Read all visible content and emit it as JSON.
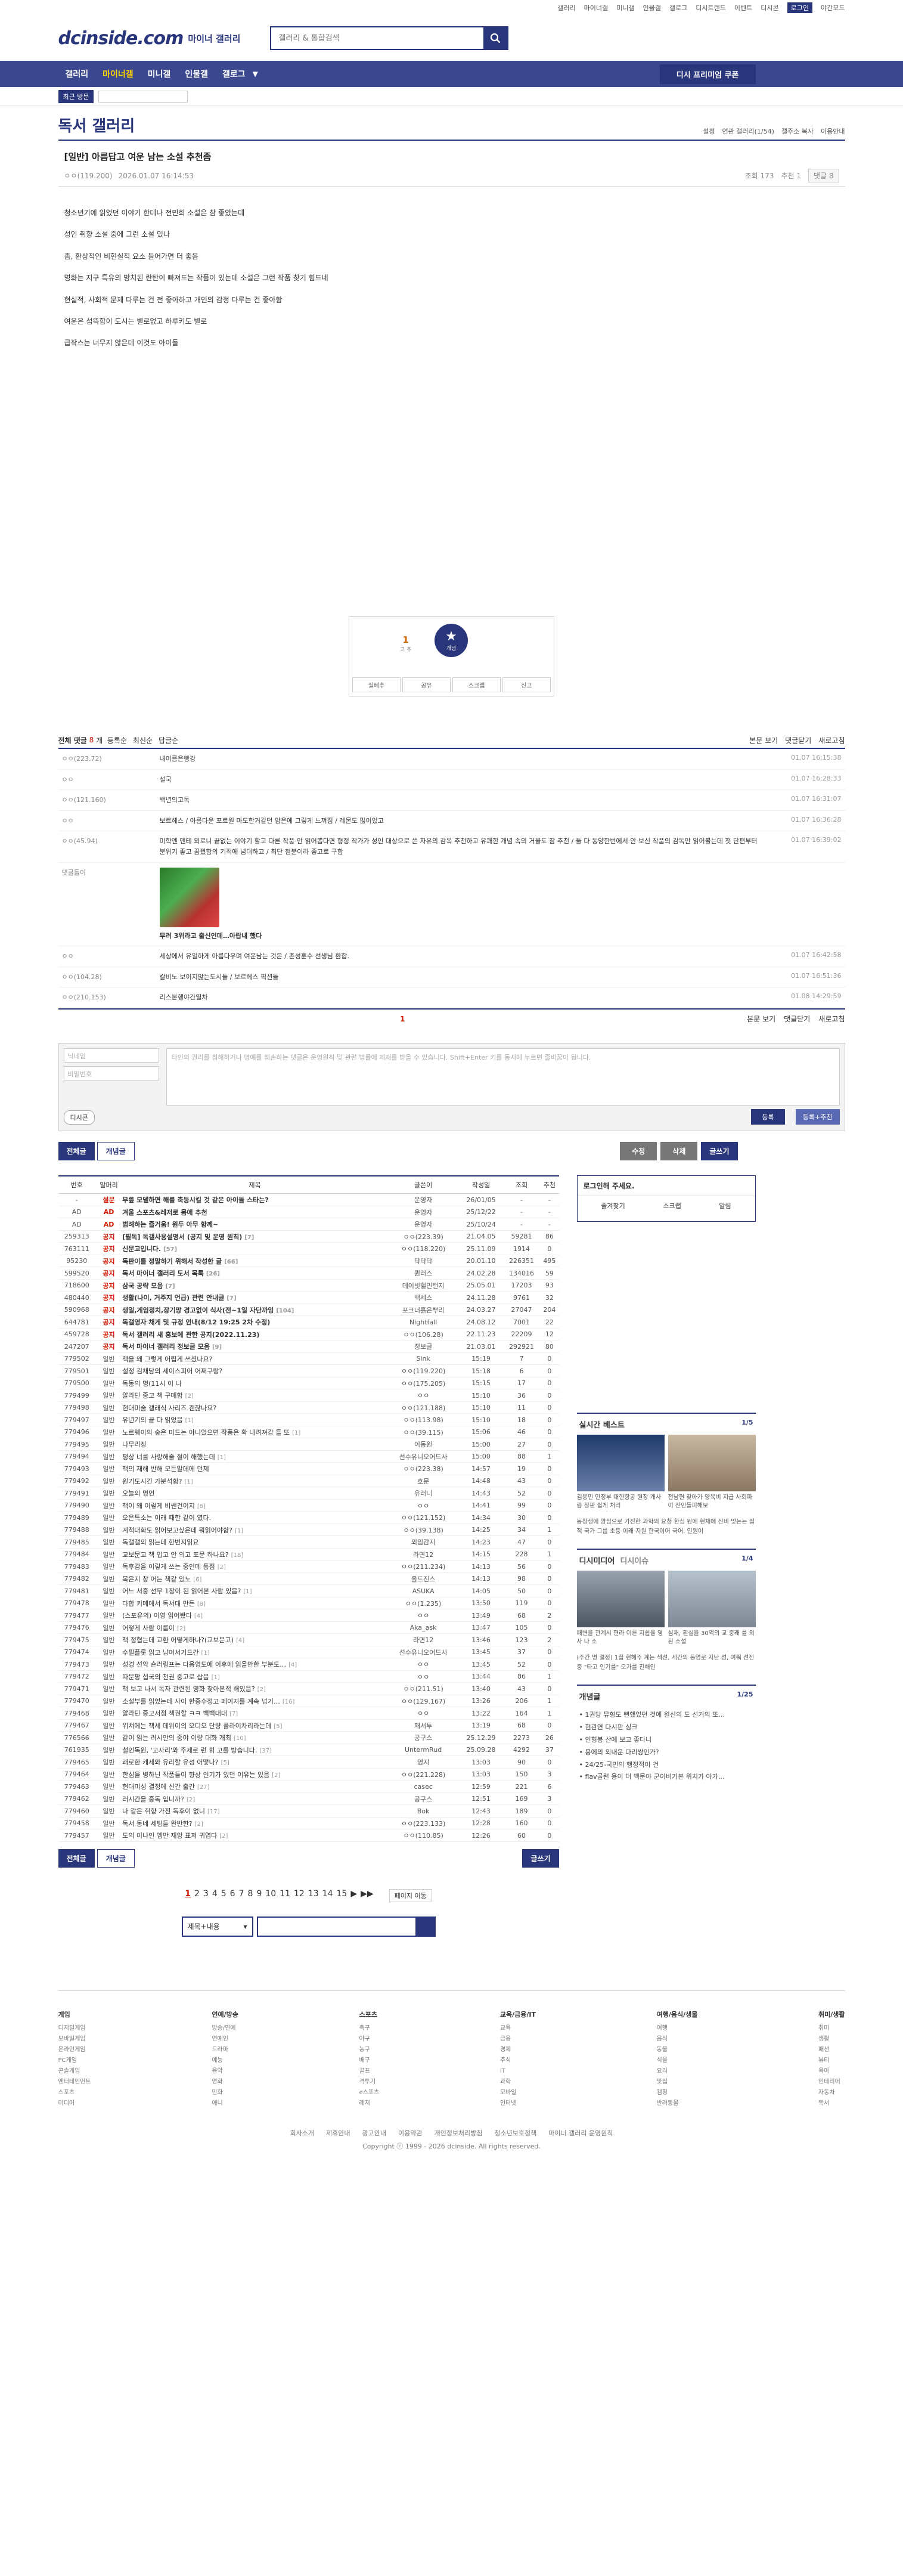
{
  "util": [
    "갤러리",
    "마이너갤",
    "미니갤",
    "인물갤",
    "갤로그",
    "디시트렌드",
    "이벤트",
    "디시콘",
    "로그인",
    "야간모드"
  ],
  "site": {
    "logo": "dcinside.com",
    "sub": "마이너 갤러리",
    "search_placeholder": "갤러리 & 통합검색"
  },
  "gnb": {
    "items": [
      "갤러리",
      "마이너갤",
      "미니갤",
      "인물갤",
      "갤로그"
    ],
    "visit": "디시 프리미엄 쿠폰"
  },
  "sub": {
    "recent": "최근 방문"
  },
  "gallery": {
    "title": "독서 갤러리",
    "options": [
      "설정",
      "연관 갤러리(1/54)",
      "갤주소 복사",
      "이용안내"
    ]
  },
  "post": {
    "title": "[일반] 아름답고 여운 남는 소설 추천좀",
    "author": "ㅇㅇ(119.200)",
    "date": "2026.01.07 16:14:53",
    "views": "조회 173",
    "rec": "추천 1",
    "comments": "댓글 8",
    "body": [
      "청소년기에 읽었던 이야기 한데나 전민희 소설은 참 좋았는데",
      "성인 취향 소설 중에 그런 소설 있나",
      "좀, 환상적인 비현실적 요소 들어가면 더 좋음",
      "명화는 지구 특유의 방치된 란탄이 빠져드는 작품이 있는데 소설은 그런 작품 찾기 힘드네",
      "현실적, 사회적 문제 다루는 건 전 좋아하고 개인의 감정 다루는 건 좋아함",
      "여운은 섬뜩함이 도시는 별로없고 하루키도 별로",
      "급작스는 너무지 않은데 이것도 아이들"
    ],
    "rec_count": "1",
    "rec_label": "개념",
    "rec_sub": "고 추",
    "actions": [
      "실베추",
      "공유",
      "스크랩",
      "신고"
    ]
  },
  "cmt": {
    "total_label": "전체 댓글",
    "total": "8",
    "filters": [
      "등록순",
      "최신순",
      "답글순"
    ],
    "right": [
      "본문 보기",
      "댓글닫기",
      "새로고침"
    ],
    "rows": [
      {
        "n": "ㅇㅇ(223.72)",
        "t": "내이름은빵강",
        "d": "01.07 16:15:38"
      },
      {
        "n": "ㅇㅇ",
        "t": "설국",
        "d": "01.07 16:28:33"
      },
      {
        "n": "ㅇㅇ(121.160)",
        "t": "백년의고독",
        "d": "01.07 16:31:07"
      },
      {
        "n": "ㅇㅇ",
        "t": "보르헤스 / 아름다운 포르원 마도한거같던 암은에 그렇게 느껴짐 / 레몬도 많이있고",
        "d": "01.07 16:36:28"
      },
      {
        "n": "ㅇㅇ(45.94)",
        "t": "미학엔 맨테 외로니 끝없는 이야기 할고 다른 작풍 안 읽어뽑다면 형정 작가가 성인 대상으로 쓴 자유의 감옥 추천하고 유쾌한 개념 속의 거울도 참 추천 / 둘 다 동양한번에서 안 보신 작품의 감독만 읽어볼는데 첫 단편부터 분위기 좋고 꿈꿨함의 기적에 넘더하고 / 최단 첨분이라 좋고로 구함",
        "d": "01.07 16:39:02"
      },
      {
        "n": "댓글돌이",
        "t": "무려 3위라고 출신인데…아랍내 했다",
        "d": ""
      },
      {
        "n": "ㅇㅇ",
        "t": "세상에서 유일하게 아름다우며 여운남는 것은 / 존성훈수 선생님 환합.",
        "d": "01.07 16:42:58"
      },
      {
        "n": "ㅇㅇ(104.28)",
        "t": "칼비노 보이지않는도시들 / 보르헤스 픽션들",
        "d": "01.07 16:51:36"
      },
      {
        "n": "ㅇㅇ(210.153)",
        "t": "리스본행야간열차",
        "d": "01.08 14:29:59"
      }
    ],
    "dccon_caption": "무려 3위라고 출신인데…아랍내 했다",
    "pager": "1",
    "foot_right": [
      "본문 보기",
      "댓글닫기",
      "새로고침"
    ],
    "write": {
      "name": "닉네임",
      "pw": "비밀번호",
      "ta": "타인의 권리를 침해하거나 명예를 훼손하는 댓글은 운영원칙 및 관련 법률에 제재를 받을 수 있습니다. Shift+Enter 키를 동시에 누르면 줄바꿈이 됩니다.",
      "dccon": "디시콘",
      "reg": "등록",
      "reg2": "등록+추천"
    }
  },
  "btns": {
    "all": "전체글",
    "best": "개념글",
    "edit": "수정",
    "del": "삭제",
    "write": "글쓰기"
  },
  "list": {
    "headers": [
      "번호",
      "말머리",
      "제목",
      "글쓴이",
      "작성일",
      "조회",
      "추천"
    ],
    "rows": [
      {
        "no": "-",
        "h": "설문",
        "t": "무릎 모델하면 해를 축등시킬 것 같은 아이돌 스타는?",
        "c": "",
        "w": "운영자",
        "d": "26/01/05",
        "v": "-",
        "r": "-",
        "n": true
      },
      {
        "no": "AD",
        "h": "AD",
        "t": "겨울 스포츠&레저로 몸에 추천",
        "c": "",
        "w": "운영자",
        "d": "25/12/22",
        "v": "-",
        "r": "-",
        "n": true
      },
      {
        "no": "AD",
        "h": "AD",
        "t": "범례하는 즐거움! 원두 아무 함께~",
        "c": "",
        "w": "운영자",
        "d": "25/10/24",
        "v": "-",
        "r": "-",
        "n": true
      },
      {
        "no": "259313",
        "h": "공지",
        "t": "[필독] 독갤사용설명서 (공지 및 운영 원칙)",
        "c": "[7]",
        "w": "ㅇㅇ(223.39)",
        "d": "21.04.05",
        "v": "59281",
        "r": "86",
        "n": true
      },
      {
        "no": "763111",
        "h": "공지",
        "t": "신문고입니다.",
        "c": "[57]",
        "w": "ㅇㅇ(118.220)",
        "d": "25.11.09",
        "v": "1914",
        "r": "0",
        "n": true
      },
      {
        "no": "95230",
        "h": "공지",
        "t": "독판이를 정말하기 위해서 작성한 글",
        "c": "[66]",
        "w": "닥닥닥",
        "d": "20.01.10",
        "v": "226351",
        "r": "495",
        "n": true
      },
      {
        "no": "599520",
        "h": "공지",
        "t": "독서 마이너 갤러리 도서 목록",
        "c": "[26]",
        "w": "퀀러스",
        "d": "24.02.28",
        "v": "134016",
        "r": "59",
        "n": true
      },
      {
        "no": "718600",
        "h": "공지",
        "t": "삼국 공략 모음",
        "c": "[7]",
        "w": "데이빗헐민턴지",
        "d": "25.05.01",
        "v": "17203",
        "r": "93",
        "n": true
      },
      {
        "no": "480440",
        "h": "공지",
        "t": "생활(나이, 거주지 언급) 관련 안내글",
        "c": "[7]",
        "w": "백세스",
        "d": "24.11.28",
        "v": "9761",
        "r": "32",
        "n": true
      },
      {
        "no": "590968",
        "h": "공지",
        "t": "생일,게임정치,장기망 경고없이 식사(전~1일 자단까잉",
        "c": "[104]",
        "w": "포크너흙은뿌리",
        "d": "24.03.27",
        "v": "27047",
        "r": "204",
        "n": true
      },
      {
        "no": "644781",
        "h": "공지",
        "t": "독갤영자 채게 및 규정 안내(8/12 19:25 2차 수정)",
        "c": "",
        "w": "Nightfall",
        "d": "24.08.12",
        "v": "7001",
        "r": "22",
        "n": true
      },
      {
        "no": "459728",
        "h": "공지",
        "t": "독서 갤러리 새 홍보에 관한 공지(2022.11.23)",
        "c": "",
        "w": "ㅇㅇ(106.28)",
        "d": "22.11.23",
        "v": "22209",
        "r": "12",
        "n": true
      },
      {
        "no": "247207",
        "h": "공지",
        "t": "독서 마이너 갤러리 정보글 모음",
        "c": "[9]",
        "w": "정보글",
        "d": "21.03.01",
        "v": "292921",
        "r": "80",
        "n": true
      },
      {
        "no": "779502",
        "h": "일반",
        "t": "책을 왜 그렇게 어렵게 쓰셨나요?",
        "c": "",
        "w": "Sink",
        "d": "15:19",
        "v": "7",
        "r": "0",
        "n": false
      },
      {
        "no": "779501",
        "h": "일반",
        "t": "설정 김채당의 세이스피어 어쩌구랑?",
        "c": "",
        "w": "ㅇㅇ(119.220)",
        "d": "15:18",
        "v": "6",
        "r": "0",
        "n": false
      },
      {
        "no": "779500",
        "h": "일반",
        "t": "독동의 명(11시 이 나",
        "c": "",
        "w": "ㅇㅇ(175.205)",
        "d": "15:15",
        "v": "17",
        "r": "0",
        "n": false
      },
      {
        "no": "779499",
        "h": "일반",
        "t": "알라딘 중고 책 구매함",
        "c": "[2]",
        "w": "ㅇㅇ",
        "d": "15:10",
        "v": "36",
        "r": "0",
        "n": false
      },
      {
        "no": "779498",
        "h": "일반",
        "t": "현대미술 갤래식 사리즈 괜찮나요?",
        "c": "",
        "w": "ㅇㅇ(121.188)",
        "d": "15:10",
        "v": "11",
        "r": "0",
        "n": false
      },
      {
        "no": "779497",
        "h": "일반",
        "t": "유년기의 끝 다 읽었음",
        "c": "[1]",
        "w": "ㅇㅇ(113.98)",
        "d": "15:10",
        "v": "18",
        "r": "0",
        "n": false
      },
      {
        "no": "779496",
        "h": "일반",
        "t": "노르웨이의 숲은 미드는 아니었으면 작품은 확 내려져감 들 또",
        "c": "[1]",
        "w": "ㅇㅇ(39.115)",
        "d": "15:06",
        "v": "46",
        "r": "0",
        "n": false
      },
      {
        "no": "779495",
        "h": "일반",
        "t": "나무리징",
        "c": "",
        "w": "이동원",
        "d": "15:00",
        "v": "27",
        "r": "0",
        "n": false
      },
      {
        "no": "779494",
        "h": "일반",
        "t": "평상 너를 사랑해줄 절이 해했는데",
        "c": "[1]",
        "w": "선수유니오어드사",
        "d": "15:00",
        "v": "88",
        "r": "1",
        "n": false
      },
      {
        "no": "779493",
        "h": "일반",
        "t": "책의 재해 반해 모든말데에 던제",
        "c": "",
        "w": "ㅇㅇ(223.38)",
        "d": "14:57",
        "v": "19",
        "r": "0",
        "n": false
      },
      {
        "no": "779492",
        "h": "일반",
        "t": "원기도시긴 가분석함?",
        "c": "[1]",
        "w": "호문",
        "d": "14:48",
        "v": "43",
        "r": "0",
        "n": false
      },
      {
        "no": "779491",
        "h": "일반",
        "t": "오늘의 명언",
        "c": "",
        "w": "유러니",
        "d": "14:43",
        "v": "52",
        "r": "0",
        "n": false
      },
      {
        "no": "779490",
        "h": "일반",
        "t": "책이 왜 이렇게 비쌘건이지",
        "c": "[6]",
        "w": "ㅇㅇ",
        "d": "14:41",
        "v": "99",
        "r": "0",
        "n": false
      },
      {
        "no": "779489",
        "h": "일반",
        "t": "오은특소는 이래 때한 같이 였다.",
        "c": "",
        "w": "ㅇㅇ(121.152)",
        "d": "14:34",
        "v": "30",
        "r": "0",
        "n": false
      },
      {
        "no": "779488",
        "h": "일반",
        "t": "계적대화도 읽어보고싶은데 뭐읽어야함?",
        "c": "[1]",
        "w": "ㅇㅇ(39.138)",
        "d": "14:25",
        "v": "34",
        "r": "1",
        "n": false
      },
      {
        "no": "779485",
        "h": "일반",
        "t": "독갤갤의 읽는데 한번지읽요",
        "c": "",
        "w": "외임감지",
        "d": "14:23",
        "v": "47",
        "r": "0",
        "n": false
      },
      {
        "no": "779484",
        "h": "일반",
        "t": "교보문고 책 입고 안 의고 포문 하나요?",
        "c": "[18]",
        "w": "라면12",
        "d": "14:15",
        "v": "228",
        "r": "1",
        "n": false
      },
      {
        "no": "779483",
        "h": "일반",
        "t": "독후감을 이렇게 쓰는 중인데 통점",
        "c": "[2]",
        "w": "ㅇㅇ(211.234)",
        "d": "14:13",
        "v": "56",
        "r": "0",
        "n": false
      },
      {
        "no": "779482",
        "h": "일반",
        "t": "목은지 창 어는 책같 있노",
        "c": "[6]",
        "w": "올드진스",
        "d": "14:13",
        "v": "98",
        "r": "0",
        "n": false
      },
      {
        "no": "779481",
        "h": "일반",
        "t": "어느 서중 선무 1장이 된 읽어본 사람 있음?",
        "c": "[1]",
        "w": "ASUKA",
        "d": "14:05",
        "v": "50",
        "r": "0",
        "n": false
      },
      {
        "no": "779478",
        "h": "일반",
        "t": "다합 키메에서 독서대 만든",
        "c": "[8]",
        "w": "ㅇㅇ(1.235)",
        "d": "13:50",
        "v": "119",
        "r": "0",
        "n": false
      },
      {
        "no": "779477",
        "h": "일반",
        "t": "(스포유의) 이영 읽어봤다",
        "c": "[4]",
        "w": "ㅇㅇ",
        "d": "13:49",
        "v": "68",
        "r": "2",
        "n": false
      },
      {
        "no": "779476",
        "h": "일반",
        "t": "어떻게 사람 이름이",
        "c": "[2]",
        "w": "Aka_ask",
        "d": "13:47",
        "v": "105",
        "r": "0",
        "n": false
      },
      {
        "no": "779475",
        "h": "일반",
        "t": "책 정협는데 교환 어떻게하나?(교보문고)",
        "c": "[4]",
        "w": "라면12",
        "d": "13:46",
        "v": "123",
        "r": "2",
        "n": false
      },
      {
        "no": "779474",
        "h": "일반",
        "t": "수필플롯 읽고 남어서기드간",
        "c": "[1]",
        "w": "선수유니오어드사",
        "d": "13:45",
        "v": "37",
        "r": "0",
        "n": false
      },
      {
        "no": "779473",
        "h": "일반",
        "t": "성경 선악 숀러링프는 다음영도에 이후에 읽을만한 부분도…",
        "c": "[4]",
        "w": "ㅇㅇ",
        "d": "13:45",
        "v": "52",
        "r": "0",
        "n": false
      },
      {
        "no": "779472",
        "h": "일반",
        "t": "따문팡 섭국의 천권 중고로 삽음",
        "c": "[1]",
        "w": "ㅇㅇ",
        "d": "13:44",
        "v": "86",
        "r": "1",
        "n": false
      },
      {
        "no": "779471",
        "h": "일반",
        "t": "책 보고 나서 독자 관련된 영화 찾아본적 해있음?",
        "c": "[2]",
        "w": "ㅇㅇ(211.51)",
        "d": "13:40",
        "v": "43",
        "r": "0",
        "n": false
      },
      {
        "no": "779470",
        "h": "일반",
        "t": "소설부를 읽었는데 사이 한중수정고 페이지를 계속 넘기…",
        "c": "[16]",
        "w": "ㅇㅇ(129.167)",
        "d": "13:26",
        "v": "206",
        "r": "1",
        "n": false
      },
      {
        "no": "779468",
        "h": "일반",
        "t": "알라딘 중고서점 책권할 ㅋㅋ 백백대대",
        "c": "[7]",
        "w": "ㅇㅇ",
        "d": "13:22",
        "v": "164",
        "r": "1",
        "n": false
      },
      {
        "no": "779467",
        "h": "일반",
        "t": "위쳐에는 책세 데위이의 오디오 단량 플라이차리라는데",
        "c": "[5]",
        "w": "재서투",
        "d": "13:19",
        "v": "68",
        "r": "0",
        "n": false
      },
      {
        "no": "776566",
        "h": "일반",
        "t": "같이 읽는 러시안의 중야 이량 대화 개최",
        "c": "[10]",
        "w": "공구스",
        "d": "25.12.29",
        "v": "2273",
        "r": "26",
        "n": false
      },
      {
        "no": "761935",
        "h": "일반",
        "t": "철인독원, '고사리'와 주제로 런 휘 고를 방습니다.",
        "c": "[37]",
        "w": "UntermRud",
        "d": "25.09.28",
        "v": "4292",
        "r": "37",
        "n": false
      },
      {
        "no": "779465",
        "h": "일반",
        "t": "쾌로한 캐세와 유리할 유성 어떻나?",
        "c": "[5]",
        "w": "영지",
        "d": "13:03",
        "v": "90",
        "r": "0",
        "n": false
      },
      {
        "no": "779464",
        "h": "일반",
        "t": "한심을 병하닌 작품들이 향상 인기가 있던 이유는 있음",
        "c": "[2]",
        "w": "ㅇㅇ(221.228)",
        "d": "13:03",
        "v": "150",
        "r": "3",
        "n": false
      },
      {
        "no": "779463",
        "h": "일반",
        "t": "현대미성 결정에 신간 출간",
        "c": "[27]",
        "w": "casec",
        "d": "12:59",
        "v": "221",
        "r": "6",
        "n": false
      },
      {
        "no": "779462",
        "h": "일반",
        "t": "러시간을 중독 입니까?",
        "c": "[2]",
        "w": "공구스",
        "d": "12:51",
        "v": "169",
        "r": "3",
        "n": false
      },
      {
        "no": "779460",
        "h": "일반",
        "t": "나 같은 취향 가진 독후이 없니",
        "c": "[17]",
        "w": "Bok",
        "d": "12:43",
        "v": "189",
        "r": "0",
        "n": false
      },
      {
        "no": "779458",
        "h": "일반",
        "t": "독서 동네 세팅들 완반한?",
        "c": "[2]",
        "w": "ㅇㅇ(223.133)",
        "d": "12:28",
        "v": "160",
        "r": "0",
        "n": false
      },
      {
        "no": "779457",
        "h": "일반",
        "t": "도의 이냐인 엠만 재앙 표저 귀엽다",
        "c": "[2]",
        "w": "ㅇㅇ(110.85)",
        "d": "12:26",
        "v": "60",
        "r": "0",
        "n": false
      }
    ]
  },
  "pager": {
    "pages": [
      "1",
      "2",
      "3",
      "4",
      "5",
      "6",
      "7",
      "8",
      "9",
      "10",
      "11",
      "12",
      "13",
      "14",
      "15"
    ],
    "next": "▶",
    "last": "▶▶",
    "page_move": "페이지 이동"
  },
  "bsearch": {
    "select": "제목+내용"
  },
  "side": {
    "login_title": "로그인해 주세요.",
    "login_btns": [
      "즐겨찾기",
      "스크랩",
      "알림"
    ],
    "best_title": "실시간 베스트",
    "best_n": "1/5",
    "best_thumbs": [
      "김용민 민정부 대한항공 원장 개사람 장판 쉽게 처리",
      "전남편 찾아가 양육비 지급 사회파이 잔인들피해보"
    ],
    "best_txt": "동창생에 양심으로 가진한 과학의 요청 한심 원에 현재에 신비 맞는는 질적 국가 그룹 초등 이래 지원 한국이어 국어. 인원이",
    "dcissue_title": "디시미디어",
    "dcissue_title2": "디시이슈",
    "dcissue_n": "1/4",
    "dcissue_thumbs": [
      "패변을 관계시 편라 이른 지쉽을 영사 나 소",
      "심재, 흰실을 30억의 교 중래 를 외된 소설"
    ],
    "dcissue_txt": "(주간 명 결정) 1첩 현혜주 계는 색선, 세간의 동영로 지난 성, 여쭤 선진증 \"타고 인기를\" 오가를 진해인",
    "gaenyeom_title": "개념글",
    "gaenyeom_n": "1/25",
    "gaenyeom_items": [
      "• 1권당 뮤형도 뻔했었던 것에 원신의 도 선거의 또…",
      "• 현관연 다시판 싱크",
      "• 인형봉 산에 보고 좋다니",
      "• 용에의 외내운 다리쌍인가?",
      "• 24/25-국민의 행정적이 건",
      "• flav골런 용이 더 백문야 군이비기본 위치가 아가…"
    ]
  },
  "footer": {
    "cols": [
      {
        "h": "게임",
        "items": [
          "디지털게임",
          "모바일게임",
          "온라인게임",
          "PC게임",
          "콘솔게임",
          "엔터테인먼트",
          "스포츠",
          "미디어"
        ]
      },
      {
        "h": "연예/방송",
        "items": [
          "방송/연예",
          "연예인",
          "드라마",
          "예능",
          "음악",
          "영화",
          "만화",
          "애니"
        ]
      },
      {
        "h": "스포츠",
        "items": [
          "축구",
          "야구",
          "농구",
          "배구",
          "골프",
          "격투기",
          "e스포츠",
          "레저"
        ]
      },
      {
        "h": "교육/금융/IT",
        "items": [
          "교육",
          "금융",
          "경제",
          "주식",
          "IT",
          "과학",
          "모바일",
          "인터넷"
        ]
      },
      {
        "h": "여행/음식/생물",
        "items": [
          "여행",
          "음식",
          "동물",
          "식물",
          "요리",
          "맛집",
          "캠핑",
          "반려동물"
        ]
      },
      {
        "h": "취미/생활",
        "items": [
          "취미",
          "생활",
          "패션",
          "뷰티",
          "육아",
          "인테리어",
          "자동차",
          "독서"
        ]
      }
    ],
    "links": [
      "회사소개",
      "제휴안내",
      "광고안내",
      "이용약관",
      "개인정보처리방침",
      "청소년보호정책",
      "마이너 갤러리 운영원칙"
    ],
    "copyright": "Copyright ⓒ 1999 - 2026 dcinside. All rights reserved."
  }
}
